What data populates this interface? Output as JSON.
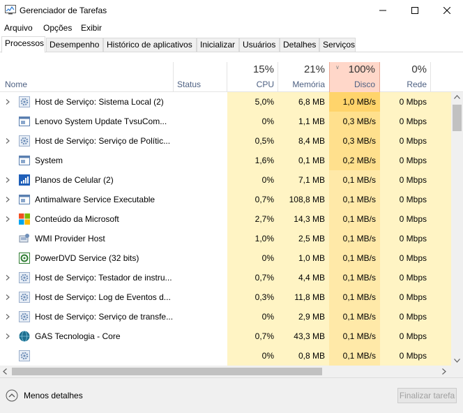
{
  "window": {
    "title": "Gerenciador de Tarefas"
  },
  "menu": [
    "Arquivo",
    "Opções",
    "Exibir"
  ],
  "tabs": [
    "Processos",
    "Desempenho",
    "Histórico de aplicativos",
    "Inicializar",
    "Usuários",
    "Detalhes",
    "Serviços"
  ],
  "active_tab": "Processos",
  "columns": {
    "name": "Nome",
    "status": "Status",
    "cpu": {
      "label": "CPU",
      "percent": "15%"
    },
    "memory": {
      "label": "Memória",
      "percent": "21%"
    },
    "disk": {
      "label": "Disco",
      "percent": "100%"
    },
    "network": {
      "label": "Rede",
      "percent": "0%"
    }
  },
  "processes": [
    {
      "name": "Host de Serviço: Sistema Local (2)",
      "cpu": "5,0%",
      "memory": "6,8 MB",
      "disk": "1,0 MB/s",
      "network": "0 Mbps",
      "expandable": true,
      "icon": "gear-icon"
    },
    {
      "name": "Lenovo System Update TvsuCom...",
      "cpu": "0%",
      "memory": "1,1 MB",
      "disk": "0,3 MB/s",
      "network": "0 Mbps",
      "expandable": false,
      "icon": "app-window-icon"
    },
    {
      "name": "Host de Serviço: Serviço de Polític...",
      "cpu": "0,5%",
      "memory": "8,4 MB",
      "disk": "0,3 MB/s",
      "network": "0 Mbps",
      "expandable": true,
      "icon": "gear-icon"
    },
    {
      "name": "System",
      "cpu": "1,6%",
      "memory": "0,1 MB",
      "disk": "0,2 MB/s",
      "network": "0 Mbps",
      "expandable": false,
      "icon": "app-window-icon"
    },
    {
      "name": "Planos de Celular (2)",
      "cpu": "0%",
      "memory": "7,1 MB",
      "disk": "0,1 MB/s",
      "network": "0 Mbps",
      "expandable": true,
      "icon": "cellular-icon"
    },
    {
      "name": "Antimalware Service Executable",
      "cpu": "0,7%",
      "memory": "108,8 MB",
      "disk": "0,1 MB/s",
      "network": "0 Mbps",
      "expandable": true,
      "icon": "app-window-icon"
    },
    {
      "name": "Conteúdo da Microsoft",
      "cpu": "2,7%",
      "memory": "14,3 MB",
      "disk": "0,1 MB/s",
      "network": "0 Mbps",
      "expandable": true,
      "icon": "microsoft-logo-icon"
    },
    {
      "name": "WMI Provider Host",
      "cpu": "1,0%",
      "memory": "2,5 MB",
      "disk": "0,1 MB/s",
      "network": "0 Mbps",
      "expandable": false,
      "icon": "wmi-icon"
    },
    {
      "name": "PowerDVD Service (32 bits)",
      "cpu": "0%",
      "memory": "1,0 MB",
      "disk": "0,1 MB/s",
      "network": "0 Mbps",
      "expandable": false,
      "icon": "powerdvd-icon"
    },
    {
      "name": "Host de Serviço: Testador de instru...",
      "cpu": "0,7%",
      "memory": "4,4 MB",
      "disk": "0,1 MB/s",
      "network": "0 Mbps",
      "expandable": true,
      "icon": "gear-icon"
    },
    {
      "name": "Host de Serviço: Log de Eventos d...",
      "cpu": "0,3%",
      "memory": "11,8 MB",
      "disk": "0,1 MB/s",
      "network": "0 Mbps",
      "expandable": true,
      "icon": "gear-icon"
    },
    {
      "name": "Host de Serviço: Serviço de transfe...",
      "cpu": "0%",
      "memory": "2,9 MB",
      "disk": "0,1 MB/s",
      "network": "0 Mbps",
      "expandable": true,
      "icon": "gear-icon"
    },
    {
      "name": "GAS Tecnologia - Core",
      "cpu": "0,7%",
      "memory": "43,3 MB",
      "disk": "0,1 MB/s",
      "network": "0 Mbps",
      "expandable": true,
      "icon": "globe-icon"
    },
    {
      "name": "",
      "cpu": "0%",
      "memory": "0,8 MB",
      "disk": "0,1 MB/s",
      "network": "0 Mbps",
      "expandable": false,
      "icon": "gear-icon"
    }
  ],
  "footer": {
    "fewer_details": "Menos detalhes",
    "end_task": "Finalizar tarefa"
  }
}
